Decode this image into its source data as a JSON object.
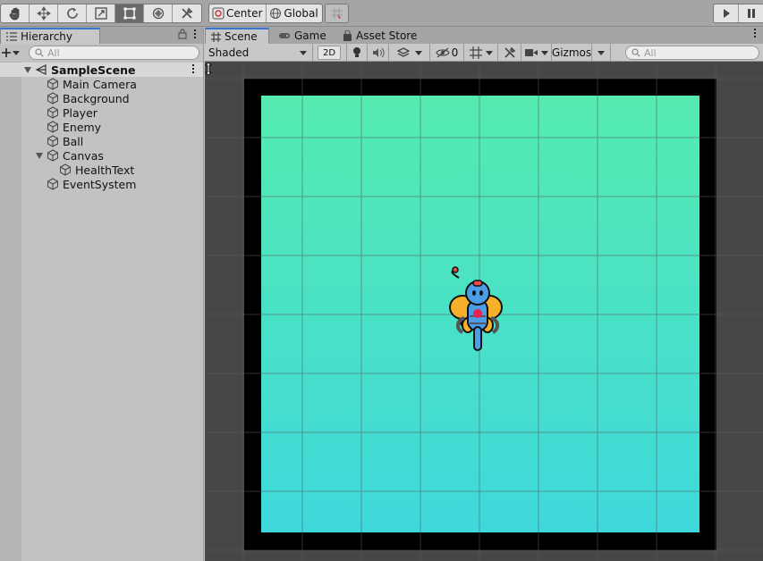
{
  "toolbar": {
    "tools": [
      {
        "name": "hand-tool",
        "icon": "hand-icon",
        "active": false
      },
      {
        "name": "move-tool",
        "icon": "move-arrows-icon",
        "active": false
      },
      {
        "name": "rotate-tool",
        "icon": "rotate-icon",
        "active": false
      },
      {
        "name": "scale-tool",
        "icon": "scale-icon",
        "active": false
      },
      {
        "name": "rect-tool",
        "icon": "rect-transform-icon",
        "active": true
      },
      {
        "name": "transform-tool",
        "icon": "transform-icon",
        "active": false
      },
      {
        "name": "custom-tool",
        "icon": "tools-icon",
        "active": false
      }
    ],
    "pivot_label": "Center",
    "rotation_label": "Global",
    "snap_icon": "grid-snap-icon",
    "play_icon": "play-icon",
    "pause_icon": "pause-icon"
  },
  "hierarchy": {
    "tab_label": "Hierarchy",
    "search_placeholder": "All",
    "scene_name": "SampleScene",
    "items": [
      {
        "label": "Main Camera",
        "depth": 1
      },
      {
        "label": "Background",
        "depth": 1
      },
      {
        "label": "Player",
        "depth": 1
      },
      {
        "label": "Enemy",
        "depth": 1
      },
      {
        "label": "Ball",
        "depth": 1
      },
      {
        "label": "Canvas",
        "depth": 1,
        "expanded": true
      },
      {
        "label": "HealthText",
        "depth": 2
      },
      {
        "label": "EventSystem",
        "depth": 1
      }
    ]
  },
  "scene": {
    "tabs": [
      {
        "label": "Scene",
        "icon": "grid-hash-icon",
        "active": true
      },
      {
        "label": "Game",
        "icon": "gamepad-icon",
        "active": false
      },
      {
        "label": "Asset Store",
        "icon": "shopping-bag-icon",
        "active": false
      }
    ],
    "shading_mode": "Shaded",
    "mode_2d_label": "2D",
    "hidden_count": "0",
    "gizmos_label": "Gizmos",
    "search_placeholder": "All"
  },
  "colors": {
    "accent_tab": "#3a72d6",
    "game_bg_top": "#55ebb0",
    "game_bg_bottom": "#3ed8dc",
    "border": "#000000",
    "viewport_bg": "#474747"
  }
}
